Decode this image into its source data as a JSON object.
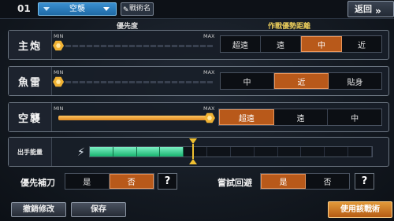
{
  "topbar": {
    "slot_number": "01",
    "mode_selected": "空襲",
    "tactic_button": "戰術名",
    "back_button": "返回"
  },
  "headers": {
    "priority": "優先度",
    "range": "作戰優勢距離"
  },
  "rows": [
    {
      "label": "主炮",
      "min_label": "MIN",
      "max_label": "MAX",
      "priority_level": 0.0,
      "options": [
        "超遠",
        "遠",
        "中",
        "近"
      ],
      "selected": "中"
    },
    {
      "label": "魚雷",
      "min_label": "MIN",
      "max_label": "MAX",
      "priority_level": 0.0,
      "options": [
        "中",
        "近",
        "貼身"
      ],
      "selected": "近"
    },
    {
      "label": "空襲",
      "min_label": "MIN",
      "max_label": "MAX",
      "priority_level": 1.0,
      "options": [
        "超遠",
        "遠",
        "中"
      ],
      "selected": "超遠"
    }
  ],
  "energy": {
    "label": "出手能量",
    "segments_total": 12,
    "segments_filled": 4,
    "threshold_segment": 4
  },
  "toggles": {
    "priority_finish": {
      "label": "優先補刀",
      "yes": "是",
      "no": "否",
      "selected": "否",
      "help": "?"
    },
    "try_evade": {
      "label": "嘗試回避",
      "yes": "是",
      "no": "否",
      "selected": "是",
      "help": "?"
    }
  },
  "bottom": {
    "undo_button": "撤銷修改",
    "save_button": "保存",
    "use_button": "使用該戰術"
  },
  "colors": {
    "accent_orange": "#b8591a",
    "energy_green": "#18b36f",
    "marker_yellow": "#f0c030",
    "header_gold": "#e6c95a",
    "mode_blue": "#1f6aa6"
  }
}
